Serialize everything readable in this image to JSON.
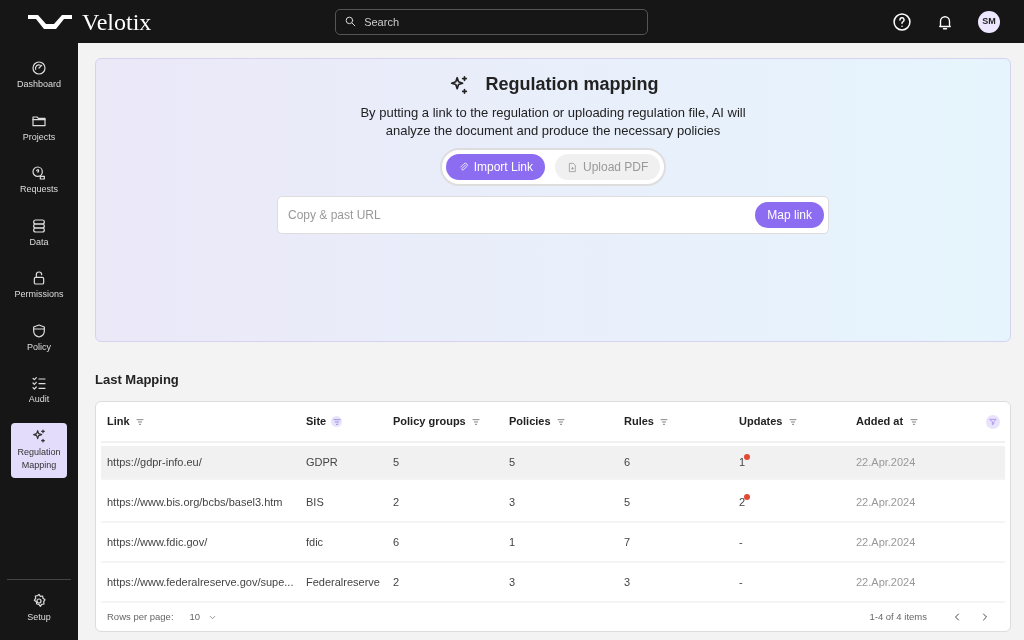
{
  "app": {
    "name": "Velotix"
  },
  "search": {
    "placeholder": "Search"
  },
  "user": {
    "initials": "SM"
  },
  "sidebar": {
    "items": [
      {
        "label": "Dashboard",
        "selected": false
      },
      {
        "label": "Projects",
        "selected": false
      },
      {
        "label": "Requests",
        "selected": false
      },
      {
        "label": "Data",
        "selected": false
      },
      {
        "label": "Permissions",
        "selected": false
      },
      {
        "label": "Policy",
        "selected": false
      },
      {
        "label": "Audit",
        "selected": false
      },
      {
        "label": "Regulation Mapping",
        "selected": true
      }
    ],
    "footer_item": {
      "label": "Setup",
      "selected": false
    }
  },
  "hero": {
    "title": "Regulation mapping",
    "description": "By putting a link to the regulation or uploading regulation file, AI will analyze the document and produce the necessary policies",
    "tabs": [
      {
        "label": "Import Link",
        "selected": true
      },
      {
        "label": "Upload PDF",
        "selected": false
      }
    ],
    "url_field": {
      "placeholder": "Copy & past URL"
    },
    "submit": "Map link"
  },
  "last_mapping": {
    "title": "Last Mapping",
    "table": {
      "columns": [
        {
          "label": "Link",
          "filter_active": false
        },
        {
          "label": "Site",
          "filter_active": true
        },
        {
          "label": "Policy groups",
          "filter_active": false
        },
        {
          "label": "Policies",
          "filter_active": false
        },
        {
          "label": "Rules",
          "filter_active": false
        },
        {
          "label": "Updates",
          "filter_active": false
        },
        {
          "label": "Added at",
          "filter_active": false
        }
      ],
      "rows": [
        {
          "cells": [
            "https://gdpr-info.eu/",
            "GDPR",
            "5",
            "5",
            "6",
            "1",
            "22.Apr.2024"
          ],
          "new_updates": true,
          "highlighted": true
        },
        {
          "cells": [
            "https://www.bis.org/bcbs/basel3.htm",
            "BIS",
            "2",
            "3",
            "5",
            "2",
            "22.Apr.2024"
          ],
          "new_updates": true,
          "highlighted": false
        },
        {
          "cells": [
            "https://www.fdic.gov/",
            "fdic",
            "6",
            "1",
            "7",
            "-",
            "22.Apr.2024"
          ],
          "new_updates": false,
          "highlighted": false
        },
        {
          "cells": [
            "https://www.federalreserve.gov/supe...",
            "Federalreserve",
            "2",
            "3",
            "3",
            "-",
            "22.Apr.2024"
          ],
          "new_updates": false,
          "highlighted": false
        }
      ]
    },
    "footer": {
      "rows_label": "Rows per page:",
      "rows_value": "10",
      "range": "1-4 of 4 items"
    }
  }
}
